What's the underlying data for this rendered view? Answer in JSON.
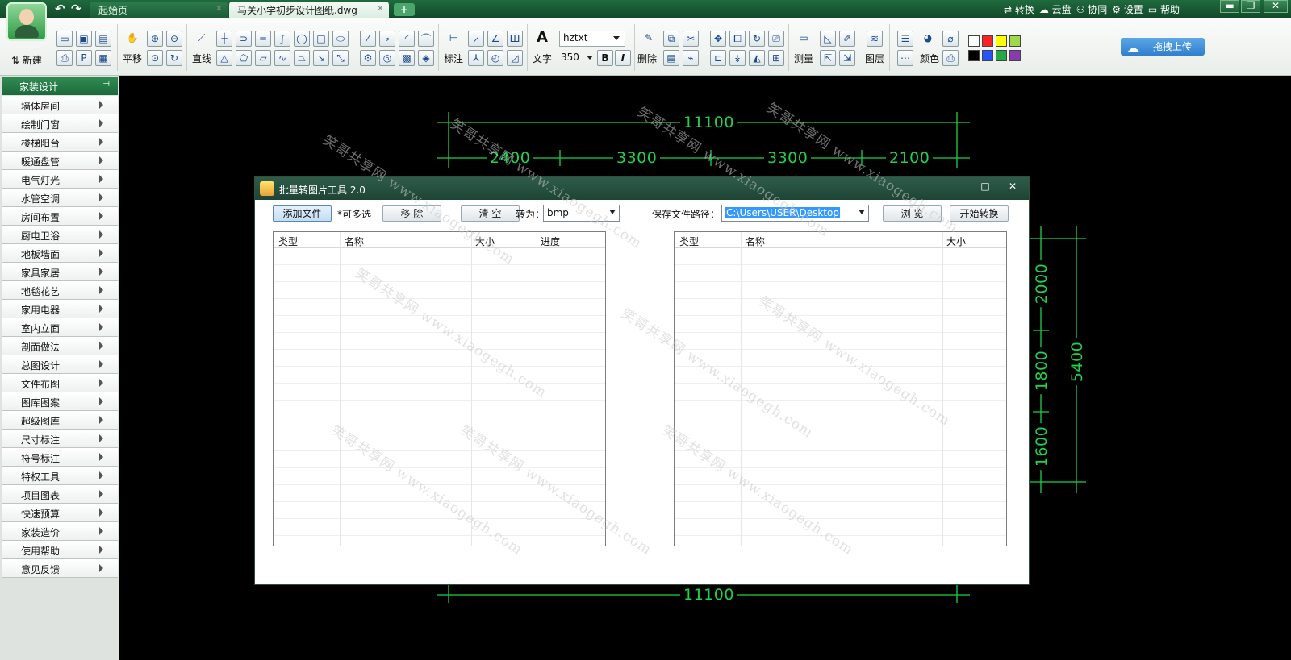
{
  "tabs": {
    "start_tab": "起始页",
    "file_tab": "马关小学初步设计图纸.dwg",
    "add_label": "+"
  },
  "top_links": [
    "⇄ 转换",
    "☁ 云盘",
    "⚇ 协同",
    "⚙ 设置",
    "▭ 帮助"
  ],
  "window_controls": [
    "▬",
    "❐",
    "✕"
  ],
  "upload_button": "拖拽上传",
  "toolbar": {
    "new_label": "新建",
    "pan_label": "平移",
    "line_label": "直线",
    "annotate_label": "标注",
    "text_label": "文字",
    "font_name": "hztxt",
    "font_size": "350",
    "bold": "B",
    "italic": "I",
    "delete_label": "删除",
    "measure_label": "测量",
    "layer_label": "图层",
    "color_label": "颜色",
    "colors": [
      "#ffffff",
      "#ff2020",
      "#ffff00",
      "#9ed84c",
      "#000000",
      "#2255ff",
      "#22aa44",
      "#8a3ab0"
    ]
  },
  "sidebar": {
    "header": "家装设计",
    "items": [
      "墙体房间",
      "绘制门窗",
      "楼梯阳台",
      "暖通盘管",
      "电气灯光",
      "水管空调",
      "房间布置",
      "厨电卫浴",
      "地板墙面",
      "家具家居",
      "地毯花艺",
      "家用电器",
      "室内立面",
      "剖面做法",
      "总图设计",
      "文件布图",
      "图库图案",
      "超级图库",
      "尺寸标注",
      "符号标注",
      "特权工具",
      "项目图表",
      "快速预算",
      "家装造价",
      "使用帮助",
      "意见反馈"
    ]
  },
  "cad_dims": {
    "top_total": "11100",
    "top_segments": [
      "2400",
      "3300",
      "3300",
      "2100"
    ],
    "bottom_total": "11100",
    "right_segments": [
      "2000",
      "1800",
      "1600"
    ],
    "right_total": "5400"
  },
  "dialog": {
    "title": "批量转图片工具 2.0",
    "add_file": "添加文件",
    "multi_hint": "*可多选",
    "remove": "移  除",
    "clear": "清  空",
    "convert_to_label": "转为：",
    "format": "bmp",
    "save_path_label": "保存文件路径：",
    "save_path": "C:\\Users\\USER\\Desktop",
    "browse": "浏  览",
    "start": "开始转换",
    "left_columns": [
      "类型",
      "名称",
      "大小",
      "进度"
    ],
    "right_columns": [
      "类型",
      "名称",
      "大小"
    ]
  },
  "watermark": {
    "text": "笑哥共享网 www.xiaogegh.com"
  }
}
